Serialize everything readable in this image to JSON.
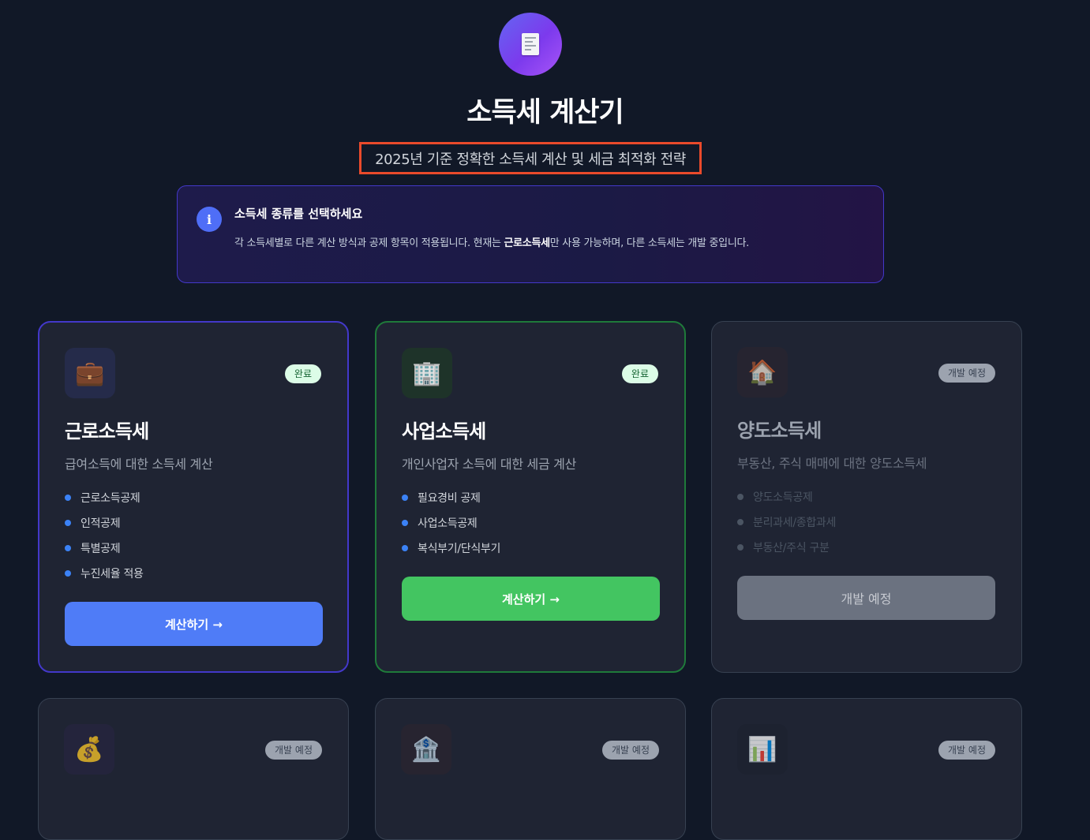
{
  "header": {
    "title": "소득세 계산기",
    "subtitle": "2025년 기준 정확한 소득세 계산 및 세금 최적화 전략",
    "icon": "receipt-icon"
  },
  "info": {
    "icon": "info-icon",
    "icon_glyph": "i",
    "title": "소득세 종류를 선택하세요",
    "desc_before": "각 소득세별로 다른 계산 방식과 공제 항목이 적용됩니다. 현재는 ",
    "desc_bold": "근로소득세",
    "desc_after": "만 사용 가능하며, 다른 소득세는 개발 중입니다."
  },
  "cards": [
    {
      "icon": "briefcase-icon",
      "emoji": "💼",
      "badge": "완료",
      "title": "근로소득세",
      "desc": "급여소득에 대한 소득세 계산",
      "features": [
        "근로소득공제",
        "인적공제",
        "특별공제",
        "누진세율 적용"
      ],
      "button": "계산하기 →"
    },
    {
      "icon": "office-building-icon",
      "emoji": "🏢",
      "badge": "완료",
      "title": "사업소득세",
      "desc": "개인사업자 소득에 대한 세금 계산",
      "features": [
        "필요경비 공제",
        "사업소득공제",
        "복식부기/단식부기"
      ],
      "button": "계산하기 →"
    },
    {
      "icon": "house-icon",
      "emoji": "🏠",
      "badge": "개발 예정",
      "title": "양도소득세",
      "desc": "부동산, 주식 매매에 대한 양도소득세",
      "features": [
        "양도소득공제",
        "분리과세/종합과세",
        "부동산/주식 구분"
      ],
      "button": "개발 예정"
    },
    {
      "icon": "money-bag-icon",
      "emoji": "💰",
      "badge": "개발 예정"
    },
    {
      "icon": "bank-icon",
      "emoji": "🏦",
      "badge": "개발 예정"
    },
    {
      "icon": "bar-chart-icon",
      "emoji": "📊",
      "badge": "개발 예정"
    }
  ],
  "colors": {
    "background": "#111827",
    "accent_blue": "#4f7cf7",
    "accent_green": "#43c561",
    "highlight_border": "#ea4a2b"
  }
}
